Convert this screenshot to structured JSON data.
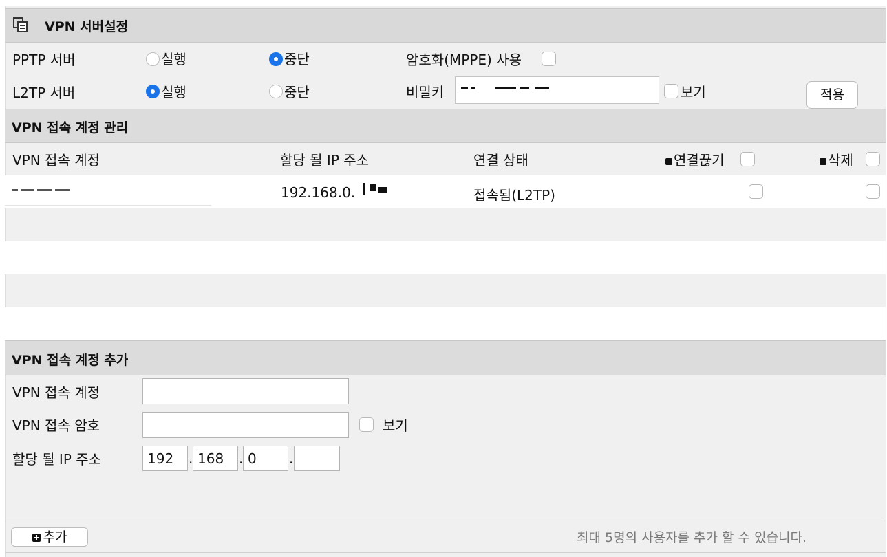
{
  "server_settings": {
    "title": "VPN 서버설정",
    "pptp_label": "PPTP 서버",
    "pptp_run": "실행",
    "pptp_stop": "중단",
    "mppe_label": "암호화(MPPE) 사용",
    "l2tp_label": "L2TP 서버",
    "l2tp_run": "실행",
    "l2tp_stop": "중단",
    "secret_label": "비밀키",
    "show_label": "보기",
    "apply_button": "적용"
  },
  "accounts": {
    "title": "VPN 접속 계정 관리",
    "columns": [
      "VPN 접속 계정",
      "할당 될 IP 주소",
      "연결 상태",
      "연결끊기",
      "삭제"
    ],
    "rows": [
      {
        "account": "",
        "ip": "192.168.0.",
        "status": "접속됨(L2TP)"
      }
    ]
  },
  "add_account": {
    "title": "VPN 접속 계정 추가",
    "account_label": "VPN 접속 계정",
    "password_label": "VPN 접속 암호",
    "show_label": "보기",
    "ip_label": "할당 될 IP 주소",
    "ip1": "192",
    "ip2": "168",
    "ip3": "0",
    "ip4": "",
    "dot": ".",
    "add_button": "추가",
    "footer_note": "최대 5명의 사용자를 추가 할 수 있습니다."
  }
}
